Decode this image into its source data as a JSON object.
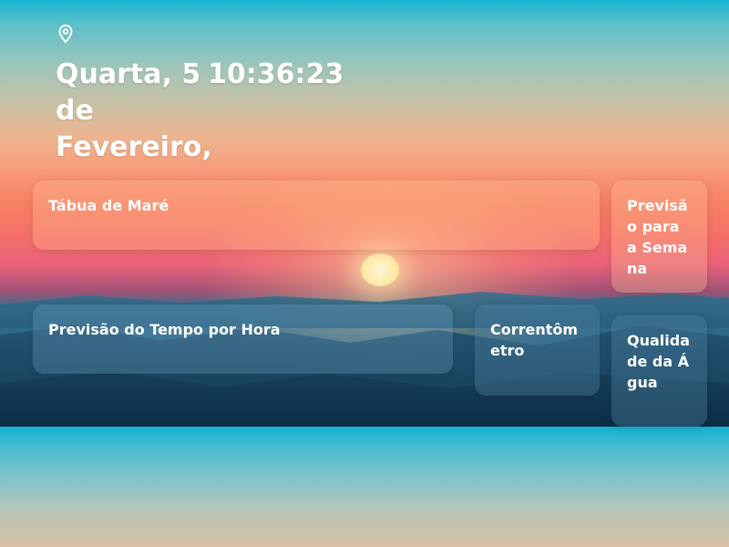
{
  "header": {
    "location_icon": "map-pin-icon",
    "date": "Quarta, 5 de Fevereiro,",
    "time": "10:36:23"
  },
  "cards": {
    "tide": {
      "label": "Tábua de Maré"
    },
    "week_forecast": {
      "label": "Previsão para a Semana"
    },
    "hourly_forecast": {
      "label": "Previsão do Tempo por Hora"
    },
    "current_meter": {
      "label": "Correntômetro"
    },
    "water_quality": {
      "label": "Qualidade da Água"
    }
  },
  "colors": {
    "text": "#ffffff",
    "sky_top": "#19b5d4",
    "sunset": "#f77e63",
    "hills": "#22587a"
  }
}
